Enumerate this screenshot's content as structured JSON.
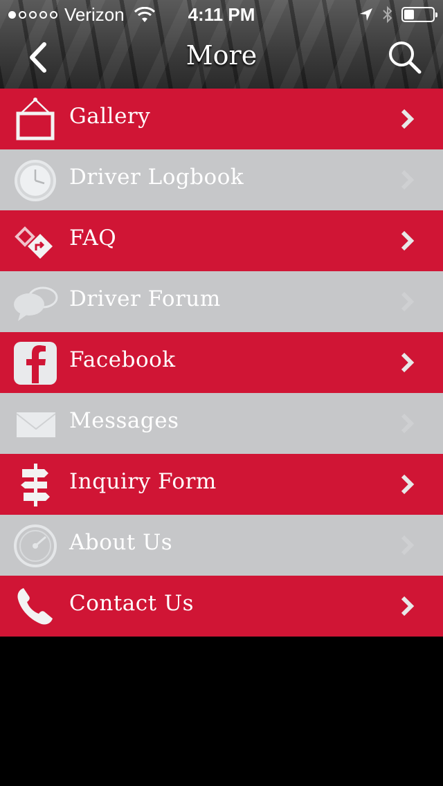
{
  "status_bar": {
    "carrier": "Verizon",
    "time": "4:11 PM",
    "signal_bars_filled": 1,
    "signal_bars_total": 5,
    "battery_level": 0.35
  },
  "nav": {
    "title": "More",
    "back_icon": "back-chevron-icon",
    "search_icon": "search-icon"
  },
  "colors": {
    "enabled_row": "#d01535",
    "disabled_row": "#c6c7c9",
    "background": "#000000"
  },
  "menu": {
    "items": [
      {
        "label": "Gallery",
        "icon": "picture-frame-icon",
        "enabled": true
      },
      {
        "label": "Driver Logbook",
        "icon": "clock-icon",
        "enabled": false
      },
      {
        "label": "FAQ",
        "icon": "road-sign-icon",
        "enabled": true
      },
      {
        "label": "Driver Forum",
        "icon": "chat-bubbles-icon",
        "enabled": false
      },
      {
        "label": "Facebook",
        "icon": "facebook-icon",
        "enabled": true
      },
      {
        "label": "Messages",
        "icon": "envelope-icon",
        "enabled": false
      },
      {
        "label": "Inquiry Form",
        "icon": "signpost-icon",
        "enabled": true
      },
      {
        "label": "About Us",
        "icon": "speedometer-icon",
        "enabled": false
      },
      {
        "label": "Contact Us",
        "icon": "phone-icon",
        "enabled": true
      }
    ]
  }
}
